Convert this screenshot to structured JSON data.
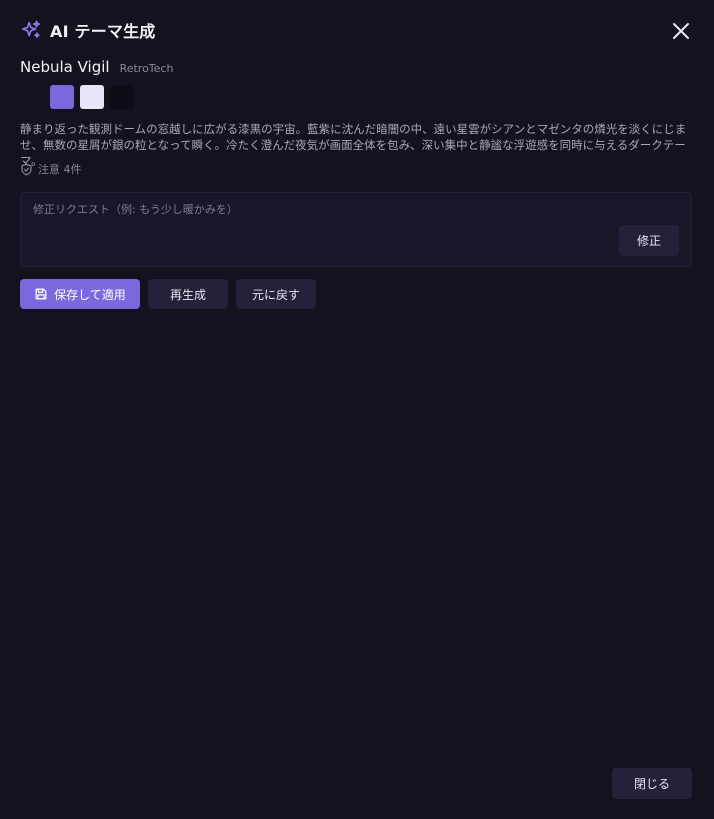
{
  "dialog": {
    "title": "AI テーマ生成",
    "close_icon": "close-icon",
    "sparkle_icon": "sparkle-icon"
  },
  "theme": {
    "name": "Nebula Vigil",
    "tag": "RetroTech",
    "swatches": [
      {
        "name": "background",
        "color": "#14121e"
      },
      {
        "name": "accent",
        "color": "#7b68dd"
      },
      {
        "name": "foreground",
        "color": "#e8e6f8"
      },
      {
        "name": "surface",
        "color": "#0e0d17"
      }
    ],
    "description": "静まり返った観測ドームの窓越しに広がる漆黒の宇宙。藍紫に沈んだ暗闇の中、遠い星雲がシアンとマゼンタの燐光を淡くにじませ、無数の星屑が銀の粒となって瞬く。冷たく澄んだ夜気が画面全体を包み、深い集中と静謐な浮遊感を同時に与えるダークテーマ。",
    "notice_label": "注意 4件",
    "notice_icon": "shield-check-icon"
  },
  "request": {
    "placeholder": "修正リクエスト（例: もう少し暖かみを）",
    "value": "",
    "fix_label": "修正"
  },
  "actions": {
    "save_label": "保存して適用",
    "save_icon": "save-icon",
    "regenerate_label": "再生成",
    "revert_label": "元に戻す"
  },
  "footer": {
    "close_label": "閉じる"
  },
  "colors": {
    "accent": "#7b68dd",
    "background": "#14121e",
    "button": "#24213a"
  }
}
